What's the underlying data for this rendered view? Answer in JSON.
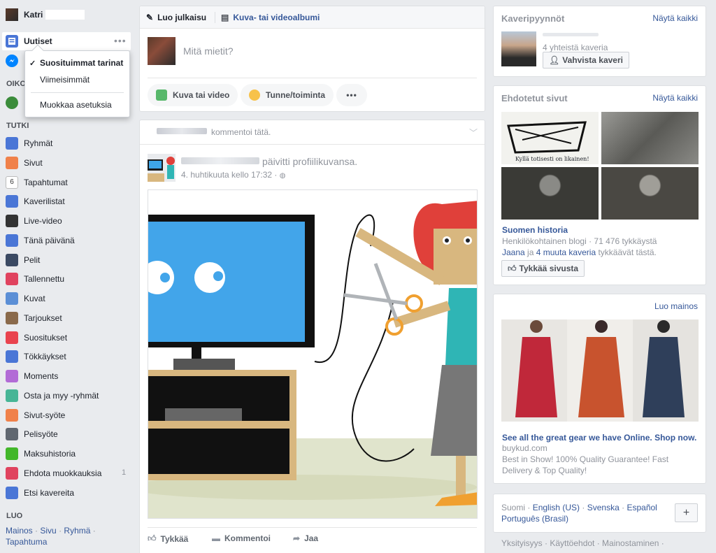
{
  "left": {
    "profile_name": "Katri",
    "news_feed": "Uutiset",
    "messenger_letter": "O",
    "shortcuts_header": "OIKO",
    "explore_header": "TUTKI",
    "explore_items": [
      {
        "label": "Ryhmät",
        "icon": "groups-icon",
        "color": "#4a76d6"
      },
      {
        "label": "Sivut",
        "icon": "pages-flag-icon",
        "color": "#f0814a"
      },
      {
        "label": "Tapahtumat",
        "icon": "calendar-icon",
        "color": "#ffffff",
        "text": "6"
      },
      {
        "label": "Kaverilistat",
        "icon": "friend-lists-icon",
        "color": "#4a76d6"
      },
      {
        "label": "Live-video",
        "icon": "live-video-icon",
        "color": "#333333"
      },
      {
        "label": "Tänä päivänä",
        "icon": "on-this-day-icon",
        "color": "#4a76d6"
      },
      {
        "label": "Pelit",
        "icon": "games-icon",
        "color": "#3b4a63"
      },
      {
        "label": "Tallennettu",
        "icon": "saved-bookmark-icon",
        "color": "#e0435f"
      },
      {
        "label": "Kuvat",
        "icon": "photos-icon",
        "color": "#5b8fd6"
      },
      {
        "label": "Tarjoukset",
        "icon": "offers-icon",
        "color": "#8a6a4b"
      },
      {
        "label": "Suositukset",
        "icon": "recommendations-icon",
        "color": "#e9434e"
      },
      {
        "label": "Tökkäykset",
        "icon": "pokes-icon",
        "color": "#4a76d6"
      },
      {
        "label": "Moments",
        "icon": "moments-icon",
        "color": "#b26bd6"
      },
      {
        "label": "Osta ja myy -ryhmät",
        "icon": "buy-sell-tag-icon",
        "color": "#47b596"
      },
      {
        "label": "Sivut-syöte",
        "icon": "pages-feed-icon",
        "color": "#f0814a"
      },
      {
        "label": "Pelisyöte",
        "icon": "gaming-controller-icon",
        "color": "#606770"
      },
      {
        "label": "Maksuhistoria",
        "icon": "payment-history-icon",
        "color": "#42b72a"
      },
      {
        "label": "Ehdota muokkauksia",
        "icon": "map-pin-icon",
        "color": "#e0435f",
        "count": "1"
      },
      {
        "label": "Etsi kavereita",
        "icon": "find-friends-icon",
        "color": "#4a76d6"
      }
    ],
    "create_header": "LUO",
    "create_links": [
      "Mainos",
      "Sivu",
      "Ryhmä",
      "Tapahtuma"
    ],
    "create_sep": "·"
  },
  "dropdown": {
    "items": [
      {
        "label": "Suosituimmat tarinat",
        "selected": true
      },
      {
        "label": "Viimeisimmät",
        "selected": false
      }
    ],
    "settings": "Muokkaa asetuksia",
    "check": "✓"
  },
  "composer": {
    "tab_post": "Luo julkaisu",
    "tab_album": "Kuva- tai videoalbumi",
    "placeholder": "Mitä mietit?",
    "btn_photo": "Kuva tai video",
    "btn_feeling": "Tunne/toiminta",
    "btn_more": "•••"
  },
  "post": {
    "header_text": "kommentoi tätä.",
    "action_text": "päivitti profiilikuvansa.",
    "timestamp": "4. huhtikuuta kello 17:32 ·",
    "like": "Tykkää",
    "comment": "Kommentoi",
    "share": "Jaa"
  },
  "friend_requests": {
    "title": "Kaveripyynnöt",
    "see_all": "Näytä kaikki",
    "mutual": "4 yhteistä kaveria",
    "confirm": "Vahvista kaveri"
  },
  "suggested_pages": {
    "title": "Ehdotetut sivut",
    "see_all": "Näytä kaikki",
    "caption": "Kyllä totisesti on likainen!",
    "page_name": "Suomen historia",
    "page_meta": "Henkilökohtainen blogi · 71 476 tykkäystä",
    "friend_name": "Jaana",
    "friend_mid": "ja",
    "friend_others": "4 muuta kaveria",
    "friend_end": "tykkäävät tästä.",
    "like_page": "Tykkää sivusta"
  },
  "ads": {
    "create_ad": "Luo mainos",
    "headline": "See all the great gear we have Online. Shop now.",
    "domain": "buykud.com",
    "body": "Best in Show! 100% Quality Guarantee! Fast Delivery & Top Quality!"
  },
  "languages": {
    "current": "Suomi",
    "options": [
      "English (US)",
      "Svenska",
      "Español",
      "Português (Brasil)"
    ],
    "sep": "·",
    "add": "+"
  },
  "footer": {
    "links": "Yksityisyys · Käyttöehdot · Mainostaminen ·"
  }
}
